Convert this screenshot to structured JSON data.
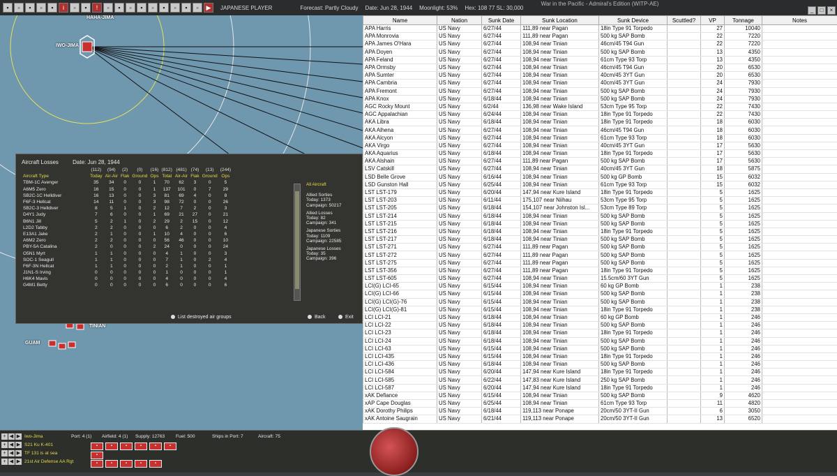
{
  "topbar": {
    "player": "JAPANESE PLAYER",
    "forecast": "Forecast: Partly Cloudy",
    "date": "Date: Jun 28, 1944",
    "moonlight": "Moonlight: 53%",
    "hex": "Hex: 108 77  SL: 30,000"
  },
  "window": {
    "title": "War in the Pacific - Admiral's Edition (WITP-AE)"
  },
  "map": {
    "labels": {
      "hahajima": "HAHA-JIMA",
      "iwojima": "IWO-JIMA",
      "tinian": "TINIAN",
      "guam": "GUAM"
    }
  },
  "losses": {
    "title": "Aircraft Losses",
    "date": "Date: Jun 28, 1944",
    "totals": [
      "(112)",
      "(94)",
      "(2)",
      "(0)",
      "(16)",
      "(812)",
      "(481)",
      "(74)",
      "(13)",
      "(244)"
    ],
    "headers": {
      "type": "Aircraft Type",
      "today": "Today",
      "air": "Air-Air",
      "flak": "Flak",
      "ground": "Ground",
      "ops": "Ops",
      "total": "Total"
    },
    "rows": [
      {
        "type": "TBM-1C Avenger",
        "v": [
          "35",
          "34",
          "0",
          "0",
          "1",
          "70",
          "62",
          "3",
          "0",
          "5"
        ]
      },
      {
        "type": "A6M5 Zero",
        "v": [
          "16",
          "15",
          "0",
          "0",
          "1",
          "137",
          "101",
          "0",
          "7",
          "29"
        ]
      },
      {
        "type": "SB2C-1C Helldiver",
        "v": [
          "16",
          "13",
          "0",
          "0",
          "3",
          "81",
          "69",
          "4",
          "0",
          "8"
        ]
      },
      {
        "type": "F6F-3 Hellcat",
        "v": [
          "14",
          "11",
          "0",
          "0",
          "3",
          "98",
          "72",
          "0",
          "0",
          "26"
        ]
      },
      {
        "type": "SB2C-3 Helldiver",
        "v": [
          "8",
          "5",
          "1",
          "0",
          "2",
          "12",
          "7",
          "2",
          "0",
          "3"
        ]
      },
      {
        "type": "D4Y1 Judy",
        "v": [
          "7",
          "6",
          "0",
          "0",
          "1",
          "69",
          "21",
          "27",
          "0",
          "21"
        ]
      },
      {
        "type": "B6N1 Jill",
        "v": [
          "5",
          "2",
          "1",
          "0",
          "2",
          "29",
          "2",
          "15",
          "0",
          "12"
        ]
      },
      {
        "type": "L2D2 Tabby",
        "v": [
          "2",
          "2",
          "0",
          "0",
          "0",
          "6",
          "2",
          "0",
          "0",
          "4"
        ]
      },
      {
        "type": "E13A1 Jake",
        "v": [
          "2",
          "1",
          "0",
          "0",
          "1",
          "10",
          "4",
          "0",
          "0",
          "6"
        ]
      },
      {
        "type": "A6M2 Zero",
        "v": [
          "2",
          "2",
          "0",
          "0",
          "0",
          "56",
          "46",
          "0",
          "0",
          "10"
        ]
      },
      {
        "type": "PBY-5A Catalina",
        "v": [
          "2",
          "0",
          "0",
          "0",
          "2",
          "24",
          "0",
          "0",
          "0",
          "24"
        ]
      },
      {
        "type": "O5N1 Myrt",
        "v": [
          "1",
          "1",
          "0",
          "0",
          "0",
          "4",
          "1",
          "0",
          "0",
          "3"
        ]
      },
      {
        "type": "SOC-1 Seagull",
        "v": [
          "1",
          "1",
          "0",
          "0",
          "0",
          "7",
          "1",
          "0",
          "2",
          "4"
        ]
      },
      {
        "type": "F6F-3N Hellcat",
        "v": [
          "1",
          "1",
          "0",
          "0",
          "0",
          "2",
          "1",
          "0",
          "0",
          "1"
        ]
      },
      {
        "type": "J1N1-S Irving",
        "v": [
          "0",
          "0",
          "0",
          "0",
          "0",
          "1",
          "0",
          "0",
          "0",
          "1"
        ]
      },
      {
        "type": "H6K4 Mavis",
        "v": [
          "0",
          "0",
          "0",
          "0",
          "0",
          "4",
          "0",
          "0",
          "0",
          "4"
        ]
      },
      {
        "type": "G4M1 Betty",
        "v": [
          "0",
          "0",
          "0",
          "0",
          "0",
          "6",
          "0",
          "0",
          "0",
          "6"
        ]
      }
    ],
    "side": {
      "title": "All Aircraft",
      "allied_sorties": "Allied Sorties",
      "allied_sorties_today": "Today:  1373",
      "allied_sorties_campaign": "Campaign: 50217",
      "allied_losses": "Allied Losses",
      "allied_losses_today": "Today:  82",
      "allied_losses_campaign": "Campaign: 341",
      "jp_sorties": "Japanese Sorties",
      "jp_sorties_today": "Today:  1109",
      "jp_sorties_campaign": "Campaign: 22585",
      "jp_losses": "Japanese Losses",
      "jp_losses_today": "Today:  35",
      "jp_losses_campaign": "Campaign: 396"
    },
    "buttons": {
      "list": "List destroyed air groups",
      "back": "Back",
      "exit": "Exit"
    }
  },
  "sunk": {
    "columns": [
      "Name",
      "Nation",
      "Sunk Date",
      "Sunk Location",
      "Sunk Device",
      "Scuttled?",
      "VP",
      "Tonnage",
      "Notes"
    ],
    "rows": [
      [
        "APA Harris",
        "US Navy",
        "6/27/44",
        "111,89 near Pagan",
        "18in Type 91 Torpedo",
        "",
        "27",
        "10040",
        ""
      ],
      [
        "APA Monrovia",
        "US Navy",
        "6/27/44",
        "111,89 near Pagan",
        "500 kg SAP Bomb",
        "",
        "22",
        "7220",
        ""
      ],
      [
        "APA James O'Hara",
        "US Navy",
        "6/27/44",
        "108,94 near Tinian",
        "46cm/45 T94 Gun",
        "",
        "22",
        "7220",
        ""
      ],
      [
        "APA Doyen",
        "US Navy",
        "6/27/44",
        "108,94 near Tinian",
        "500 kg SAP Bomb",
        "",
        "13",
        "4350",
        ""
      ],
      [
        "APA Feland",
        "US Navy",
        "6/27/44",
        "108,94 near Tinian",
        "61cm Type 93 Torp",
        "",
        "13",
        "4350",
        ""
      ],
      [
        "APA Ormsby",
        "US Navy",
        "6/27/44",
        "108,94 near Tinian",
        "46cm/45 T94 Gun",
        "",
        "20",
        "6530",
        ""
      ],
      [
        "APA Sumter",
        "US Navy",
        "6/27/44",
        "108,94 near Tinian",
        "40cm/45 3YT Gun",
        "",
        "20",
        "6530",
        ""
      ],
      [
        "APA Cambria",
        "US Navy",
        "6/27/44",
        "108,94 near Tinian",
        "40cm/45 3YT Gun",
        "",
        "24",
        "7930",
        ""
      ],
      [
        "APA Fremont",
        "US Navy",
        "6/27/44",
        "108,94 near Tinian",
        "500 kg SAP Bomb",
        "",
        "24",
        "7930",
        ""
      ],
      [
        "APA Knox",
        "US Navy",
        "6/18/44",
        "108,94 near Tinian",
        "500 kg SAP Bomb",
        "",
        "24",
        "7930",
        ""
      ],
      [
        "AGC Rocky Mount",
        "US Navy",
        "6/2/44",
        "136,98 near Wake Island",
        "53cm Type 95 Torp",
        "",
        "22",
        "7430",
        ""
      ],
      [
        "AGC Appalachian",
        "US Navy",
        "6/24/44",
        "108,94 near Tinian",
        "18in Type 91 Torpedo",
        "",
        "22",
        "7430",
        ""
      ],
      [
        "AKA Libra",
        "US Navy",
        "6/18/44",
        "108,94 near Tinian",
        "18in Type 91 Torpedo",
        "",
        "18",
        "6030",
        ""
      ],
      [
        "AKA Alhena",
        "US Navy",
        "6/27/44",
        "108,94 near Tinian",
        "46cm/45 T94 Gun",
        "",
        "18",
        "6030",
        ""
      ],
      [
        "AKA Alcyon",
        "US Navy",
        "6/27/44",
        "108,94 near Tinian",
        "61cm Type 93 Torp",
        "",
        "18",
        "6030",
        ""
      ],
      [
        "AKA Virgo",
        "US Navy",
        "6/27/44",
        "108,94 near Tinian",
        "40cm/45 3YT Gun",
        "",
        "17",
        "5630",
        ""
      ],
      [
        "AKA Aquarius",
        "US Navy",
        "6/18/44",
        "108,94 near Tinian",
        "18in Type 91 Torpedo",
        "",
        "17",
        "5630",
        ""
      ],
      [
        "AKA Alshain",
        "US Navy",
        "6/27/44",
        "111,89 near Pagan",
        "500 kg SAP Bomb",
        "",
        "17",
        "5630",
        ""
      ],
      [
        "LSV Catskill",
        "US Navy",
        "6/27/44",
        "108,94 near Tinian",
        "40cm/45 3YT Gun",
        "",
        "18",
        "5875",
        ""
      ],
      [
        "LSD Belle Grove",
        "US Navy",
        "6/16/44",
        "108,94 near Tinian",
        "500 kg GP Bomb",
        "",
        "15",
        "6032",
        ""
      ],
      [
        "LSD Gunston Hall",
        "US Navy",
        "6/25/44",
        "108,94 near Tinian",
        "61cm Type 93 Torp",
        "",
        "15",
        "6032",
        ""
      ],
      [
        "LST LST-179",
        "US Navy",
        "6/20/44",
        "147,94 near Kure Island",
        "18in Type 91 Torpedo",
        "",
        "5",
        "1625",
        ""
      ],
      [
        "LST LST-203",
        "US Navy",
        "6/11/44",
        "175,107 near Niihau",
        "53cm Type 95 Torp",
        "",
        "5",
        "1625",
        ""
      ],
      [
        "LST LST-205",
        "US Navy",
        "6/18/44",
        "154,107 near Johnston Isl...",
        "53cm Type 89 Torp",
        "",
        "5",
        "1625",
        ""
      ],
      [
        "LST LST-214",
        "US Navy",
        "6/18/44",
        "108,94 near Tinian",
        "500 kg SAP Bomb",
        "",
        "5",
        "1625",
        ""
      ],
      [
        "LST LST-215",
        "US Navy",
        "6/18/44",
        "108,94 near Tinian",
        "500 kg SAP Bomb",
        "",
        "5",
        "1625",
        ""
      ],
      [
        "LST LST-216",
        "US Navy",
        "6/18/44",
        "108,94 near Tinian",
        "18in Type 91 Torpedo",
        "",
        "5",
        "1625",
        ""
      ],
      [
        "LST LST-217",
        "US Navy",
        "6/18/44",
        "108,94 near Tinian",
        "500 kg SAP Bomb",
        "",
        "5",
        "1625",
        ""
      ],
      [
        "LST LST-271",
        "US Navy",
        "6/27/44",
        "111,89 near Pagan",
        "500 kg SAP Bomb",
        "",
        "5",
        "1625",
        ""
      ],
      [
        "LST LST-272",
        "US Navy",
        "6/27/44",
        "111,89 near Pagan",
        "500 kg SAP Bomb",
        "",
        "5",
        "1625",
        ""
      ],
      [
        "LST LST-275",
        "US Navy",
        "6/27/44",
        "111,89 near Pagan",
        "500 kg SAP Bomb",
        "",
        "5",
        "1625",
        ""
      ],
      [
        "LST LST-356",
        "US Navy",
        "6/27/44",
        "111,89 near Pagan",
        "18in Type 91 Torpedo",
        "",
        "5",
        "1625",
        ""
      ],
      [
        "LST LST-605",
        "US Navy",
        "6/27/44",
        "108,94 near Tinian",
        "15.5cm/60 3YT Gun",
        "",
        "5",
        "1625",
        ""
      ],
      [
        "LCI(G) LCI-65",
        "US Navy",
        "6/15/44",
        "108,94 near Tinian",
        "60 kg GP Bomb",
        "",
        "1",
        "238",
        ""
      ],
      [
        "LCI(G) LCI-66",
        "US Navy",
        "6/15/44",
        "108,94 near Tinian",
        "500 kg SAP Bomb",
        "",
        "1",
        "238",
        ""
      ],
      [
        "LCI(G) LCI(G)-76",
        "US Navy",
        "6/15/44",
        "108,94 near Tinian",
        "500 kg SAP Bomb",
        "",
        "1",
        "238",
        ""
      ],
      [
        "LCI(G) LCI(G)-81",
        "US Navy",
        "6/15/44",
        "108,94 near Tinian",
        "18in Type 91 Torpedo",
        "",
        "1",
        "238",
        ""
      ],
      [
        "LCI LCI-21",
        "US Navy",
        "6/18/44",
        "108,94 near Tinian",
        "60 kg GP Bomb",
        "",
        "1",
        "246",
        ""
      ],
      [
        "LCI LCI-22",
        "US Navy",
        "6/18/44",
        "108,94 near Tinian",
        "500 kg SAP Bomb",
        "",
        "1",
        "246",
        ""
      ],
      [
        "LCI LCI-23",
        "US Navy",
        "6/18/44",
        "108,94 near Tinian",
        "18in Type 91 Torpedo",
        "",
        "1",
        "246",
        ""
      ],
      [
        "LCI LCI-24",
        "US Navy",
        "6/18/44",
        "108,94 near Tinian",
        "500 kg SAP Bomb",
        "",
        "1",
        "246",
        ""
      ],
      [
        "LCI LCI-63",
        "US Navy",
        "6/15/44",
        "108,94 near Tinian",
        "500 kg SAP Bomb",
        "",
        "1",
        "246",
        ""
      ],
      [
        "LCI LCI-435",
        "US Navy",
        "6/15/44",
        "108,94 near Tinian",
        "18in Type 91 Torpedo",
        "",
        "1",
        "246",
        ""
      ],
      [
        "LCI LCI-436",
        "US Navy",
        "6/18/44",
        "108,94 near Tinian",
        "500 kg SAP Bomb",
        "",
        "1",
        "246",
        ""
      ],
      [
        "LCI LCI-584",
        "US Navy",
        "6/20/44",
        "147,94 near Kure Island",
        "18in Type 91 Torpedo",
        "",
        "1",
        "246",
        ""
      ],
      [
        "LCI LCI-585",
        "US Navy",
        "6/22/44",
        "147,83 near Kure Island",
        "250 kg SAP Bomb",
        "",
        "1",
        "246",
        ""
      ],
      [
        "LCI LCI-587",
        "US Navy",
        "6/20/44",
        "147,94 near Kure Island",
        "18in Type 91 Torpedo",
        "",
        "1",
        "246",
        ""
      ],
      [
        "xAK Defiance",
        "US Navy",
        "6/15/44",
        "108,94 near Tinian",
        "500 kg SAP Bomb",
        "",
        "9",
        "4620",
        ""
      ],
      [
        "xAP Cape Douglas",
        "US Navy",
        "6/25/44",
        "108,94 near Tinian",
        "61cm Type 93 Torp",
        "",
        "11",
        "4820",
        ""
      ],
      [
        "xAK Dorothy Philips",
        "US Navy",
        "6/18/44",
        "119,113 near Ponape",
        "20cm/50 3YT-II Gun",
        "",
        "6",
        "3050",
        ""
      ],
      [
        "xAK Antoine Saugrain",
        "US Navy",
        "6/21/44",
        "119,113 near Ponape",
        "20cm/50 3YT-II Gun",
        "",
        "13",
        "6520",
        ""
      ]
    ]
  },
  "bottom": {
    "rows": [
      "Iwo-Jima",
      "S21 Ku K-401",
      "TF 131 is at sea",
      "21st Air Defense AA Rgt"
    ],
    "port": "Port: 4 (1)",
    "airfield": "Airfield: 4 (1)",
    "supply": "Supply: 12763",
    "fuel": "Fuel: 500",
    "ships": "Ships in Port: 7",
    "aircraft": "Aircraft: 75"
  }
}
